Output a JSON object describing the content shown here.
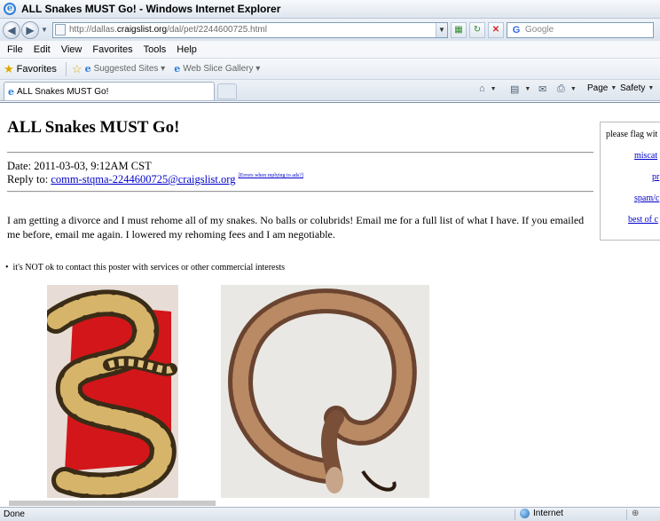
{
  "window": {
    "title": "ALL Snakes MUST Go! - Windows Internet Explorer"
  },
  "address": {
    "prefix": "http://dallas.",
    "domain": "craigslist.org",
    "path": "/dal/pet/2244600725.html",
    "search_placeholder": "Google"
  },
  "menu": [
    "File",
    "Edit",
    "View",
    "Favorites",
    "Tools",
    "Help"
  ],
  "favorites_bar": {
    "favorites": "Favorites",
    "suggested": "Suggested Sites",
    "webslice": "Web Slice Gallery"
  },
  "tab": {
    "title": "ALL Snakes MUST Go!"
  },
  "command_bar": {
    "page": "Page",
    "safety": "Safety"
  },
  "post": {
    "title": "ALL Snakes MUST Go!",
    "date": "Date: 2011-03-03, 9:12AM CST",
    "reply_label": "Reply to: ",
    "reply_email": "comm-stqma-2244600725@craigslist.org",
    "reply_errors": "[Errors when replying to ads?]",
    "body": "I am getting a divorce and I must rehome all of my snakes. No balls or colubrids! Email me for a full list of what I have. If you emailed me before, email me again. I lowered my rehoming fees and I am negotiable.",
    "notice": "it's NOT ok to contact this poster with services or other commercial interests"
  },
  "flag_box": {
    "heading": "please flag wit",
    "links": [
      "miscat",
      "pr",
      "spam/c",
      "best of c"
    ]
  },
  "status": {
    "left": "Done",
    "zone": "Internet",
    "zoom": "⊕"
  }
}
